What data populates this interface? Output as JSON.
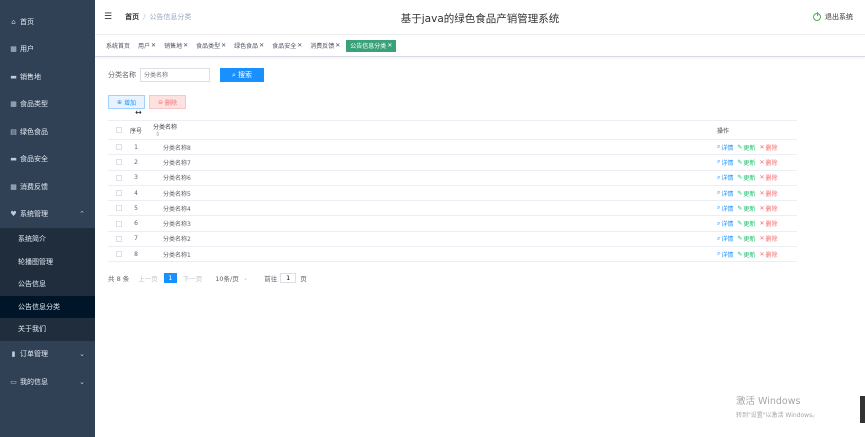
{
  "colors": {
    "sidebar_bg": "#304156",
    "active_tag": "#3aa27a",
    "primary": "#1890ff",
    "danger": "#f56c6c",
    "success": "#19be6b"
  },
  "sidebar": {
    "items": [
      {
        "label": "首页",
        "icon": "home-icon"
      },
      {
        "label": "用户",
        "icon": "grid-icon"
      },
      {
        "label": "销售地",
        "icon": "card-icon"
      },
      {
        "label": "食品类型",
        "icon": "grid-icon"
      },
      {
        "label": "绿色食品",
        "icon": "doc-icon"
      },
      {
        "label": "食品安全",
        "icon": "card-icon"
      },
      {
        "label": "消费反馈",
        "icon": "grid-icon"
      },
      {
        "label": "系统管理",
        "icon": "heart-icon",
        "expanded": true
      }
    ],
    "sub_items": [
      "系统简介",
      "轮播图管理",
      "公告信息",
      "公告信息分类",
      "关于我们"
    ],
    "active_sub": "公告信息分类",
    "bottom_items": [
      {
        "label": "订单管理",
        "icon": "bar-chart-icon"
      },
      {
        "label": "我的信息",
        "icon": "id-card-icon"
      }
    ]
  },
  "header": {
    "breadcrumb_home": "首页",
    "breadcrumb_current": "公告信息分类",
    "title": "基于java的绿色食品产销管理系统",
    "logout": "退出系统"
  },
  "tags": [
    "系统首页",
    "用户",
    "销售地",
    "食品类型",
    "绿色食品",
    "食品安全",
    "消费反馈",
    "公告信息分类"
  ],
  "search": {
    "label": "分类名称",
    "placeholder": "分类名称",
    "button": "搜索"
  },
  "actions": {
    "add": "增加",
    "delete": "删除"
  },
  "table": {
    "headers": {
      "no": "序号",
      "name": "分类名称",
      "ops": "操作"
    },
    "op_labels": {
      "detail": "详情",
      "edit": "更新",
      "delete": "删除"
    },
    "rows": [
      {
        "no": "1",
        "name": "分类名称8"
      },
      {
        "no": "2",
        "name": "分类名称7"
      },
      {
        "no": "3",
        "name": "分类名称6"
      },
      {
        "no": "4",
        "name": "分类名称5"
      },
      {
        "no": "5",
        "name": "分类名称4"
      },
      {
        "no": "6",
        "name": "分类名称3"
      },
      {
        "no": "7",
        "name": "分类名称2"
      },
      {
        "no": "8",
        "name": "分类名称1"
      }
    ]
  },
  "pager": {
    "total": "共 8 条",
    "prev": "上一页",
    "page": "1",
    "next": "下一页",
    "size": "10条/页",
    "goto": "前往",
    "jump_value": "1",
    "page_unit": "页"
  },
  "watermark": {
    "line1": "激活 Windows",
    "line2": "转到\"设置\"以激活 Windows。"
  }
}
